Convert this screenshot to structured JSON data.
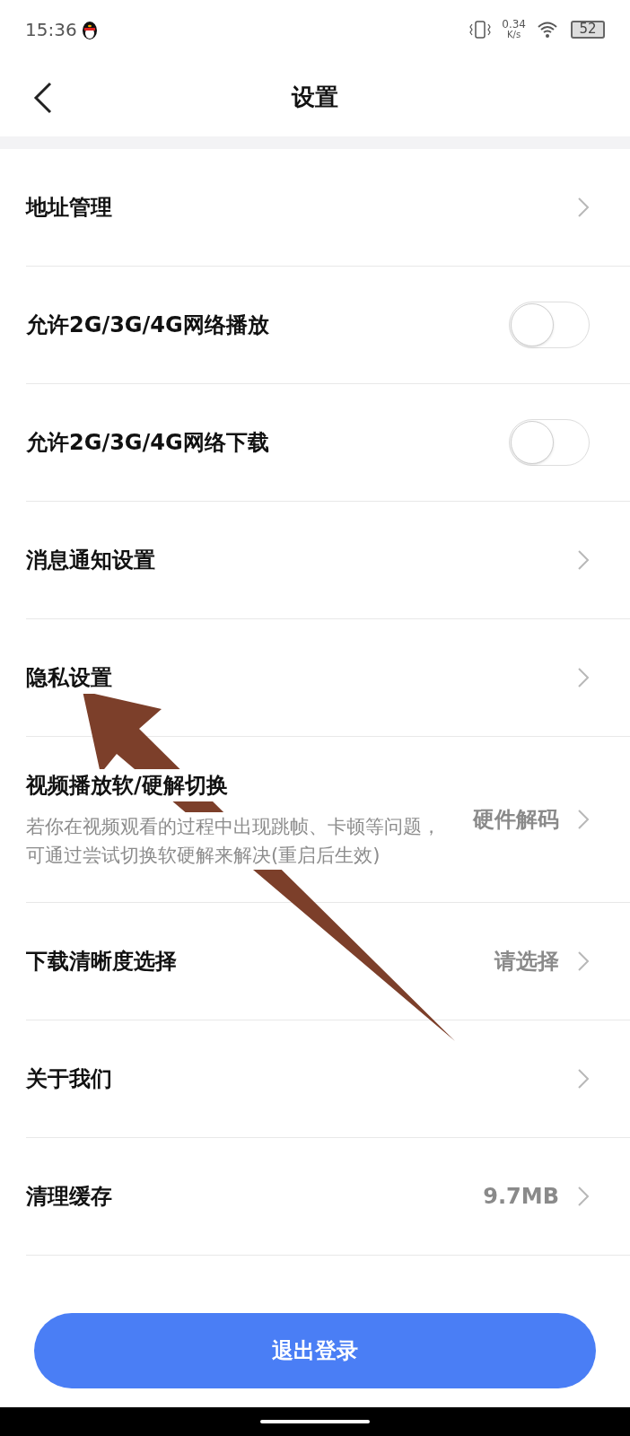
{
  "status_bar": {
    "time": "15:36",
    "speed_value": "0.34",
    "speed_unit": "K/s",
    "battery": "52"
  },
  "header": {
    "title": "设置"
  },
  "rows": [
    {
      "kind": "link",
      "label": "地址管理"
    },
    {
      "kind": "toggle",
      "label": "允许2G/3G/4G网络播放",
      "on": false
    },
    {
      "kind": "toggle",
      "label": "允许2G/3G/4G网络下载",
      "on": false
    },
    {
      "kind": "link",
      "label": "消息通知设置"
    },
    {
      "kind": "link",
      "label": "隐私设置"
    },
    {
      "kind": "link",
      "label": "视频播放软/硬解切换",
      "description": "若你在视频观看的过程中出现跳帧、卡顿等问题，可通过尝试切换软硬解来解决(重启后生效)",
      "value": "硬件解码"
    },
    {
      "kind": "link",
      "label": "下载清晰度选择",
      "value": "请选择"
    },
    {
      "kind": "link",
      "label": "关于我们"
    },
    {
      "kind": "link",
      "label": "清理缓存",
      "value": "9.7MB"
    }
  ],
  "logout_button": "退出登录"
}
